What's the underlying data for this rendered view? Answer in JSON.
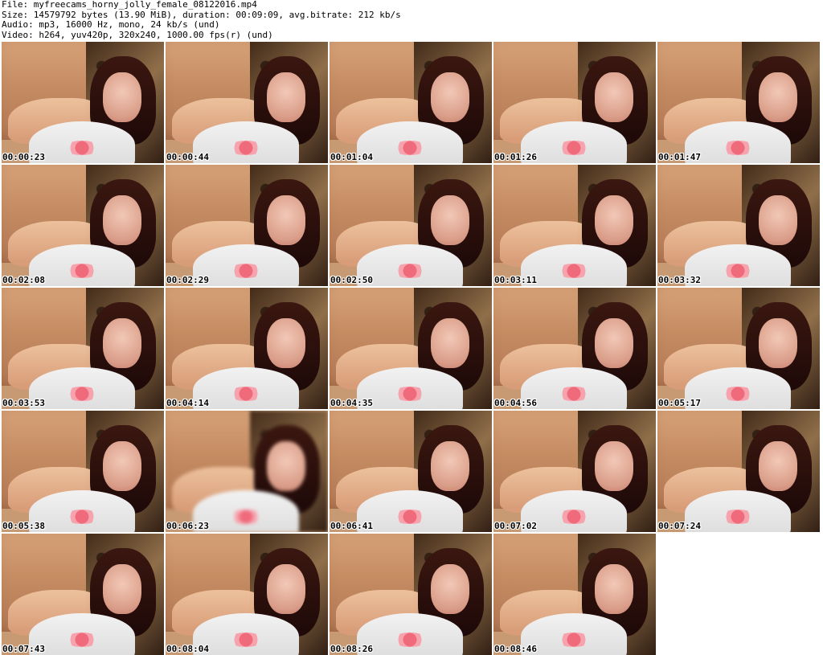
{
  "header": {
    "line1": "File: myfreecams_horny_jolly_female_08122016.mp4",
    "line2": "Size: 14579792 bytes (13.90 MiB), duration: 00:09:09, avg.bitrate: 212 kb/s",
    "line3": "Audio: mp3, 16000 Hz, mono, 24 kb/s (und)",
    "line4": "Video: h264, yuv420p, 320x240, 1000.00 fps(r) (und)"
  },
  "thumbnails": [
    {
      "time": "00:00:23"
    },
    {
      "time": "00:00:44"
    },
    {
      "time": "00:01:04"
    },
    {
      "time": "00:01:26"
    },
    {
      "time": "00:01:47"
    },
    {
      "time": "00:02:08"
    },
    {
      "time": "00:02:29"
    },
    {
      "time": "00:02:50"
    },
    {
      "time": "00:03:11"
    },
    {
      "time": "00:03:32"
    },
    {
      "time": "00:03:53"
    },
    {
      "time": "00:04:14"
    },
    {
      "time": "00:04:35"
    },
    {
      "time": "00:04:56"
    },
    {
      "time": "00:05:17"
    },
    {
      "time": "00:05:38"
    },
    {
      "time": "00:06:23"
    },
    {
      "time": "00:06:41"
    },
    {
      "time": "00:07:02"
    },
    {
      "time": "00:07:24"
    },
    {
      "time": "00:07:43"
    },
    {
      "time": "00:08:04"
    },
    {
      "time": "00:08:26"
    },
    {
      "time": "00:08:46"
    }
  ],
  "colors": {
    "background": "#ffffff",
    "text": "#000000",
    "sofa": "#c48a61",
    "hair": "#2a0f0b"
  }
}
